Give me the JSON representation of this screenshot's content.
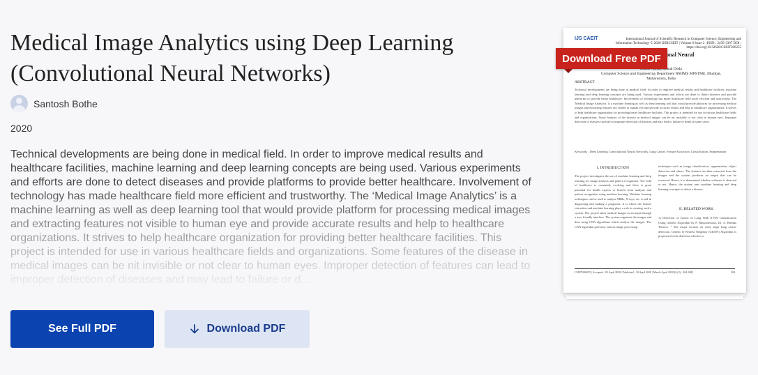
{
  "paper": {
    "title": "Medical Image Analytics using Deep Learning (Convolutional Neural Networks)",
    "author": "Santosh Bothe",
    "year": "2020",
    "abstract": "Technical developments are being done in medical field. In order to improve medical results and healthcare facilities, machine learning and deep learning concepts are being used. Various experiments and efforts are done to detect diseases and provide platforms to provide better healthcare. Involvement of technology has made healthcare field more efficient and trustworthy. The ‘Medical Image Analytics’ is a machine learning as well as deep learning tool that would provide platform for processing medical images and extracting features not visible to human eye and provide accurate results and help to healthcare organizations. It strives to help healthcare organization for providing better healthcare facilities. This project is intended for use in various healthcare fields and organizations. Some features of the disease in medical images can be nit invisible or not clear to human eyes. Improper detection of features can lead to improper detection of diseases and may lead to failure or d..."
  },
  "buttons": {
    "see_full_pdf": "See Full PDF",
    "download_pdf": "Download PDF"
  },
  "preview": {
    "badge": "Download Free PDF",
    "logo": "IJS CAEIT",
    "header": "International Journal of Scientific Research in Computer Science, Engineering and Information Technology © 2020 IJSRCSEIT | Volume 6 Issue 2 | ISSN : 2456-3307 DOI : https://doi.org/10.32628/CSEIT206255",
    "title_partial": "rning (Convolutional Neural",
    "authors": "Dhara Patidar, Kunal Doda\nComputer Science and Engineering Department NMIMS MPSTME, Mumbai, Maharashtra, India",
    "abstract_heading": "ABSTRACT",
    "abstract_text": "Technical developments are being done in medical field. In order to improve medical results and healthcare facilities, machine learning and deep learning concepts are being used. Various experiments and efforts are done to detect diseases and provide platforms to provide better healthcare. Involvement of technology has made healthcare field more efficient and trustworthy. The 'Medical Image Analytics' is a machine learning as well as deep learning tool that would provide platform for processing medical images and extracting features not visible to human eye and provide accurate results and help to healthcare organizations. It strives to help healthcare organization for providing better healthcare facilities. This project is intended for use in various healthcare fields and organizations. Some features of the disease in medical images can be nit invisible or not clear to human eyes. Improper detection of features can lead to improper detection of diseases and may lead to failure or death in some cases.",
    "keywords": "Keywords : Deep Learning Convolutional Neural Networks, Lung Cancer, Feature Extraction, Classification, Segmentation",
    "intro_heading": "I.   INTRODUCTION",
    "intro_text": "The project investigates the use of machine learning and deep learning for image analysis and pattern recognition. The field of healthcare is constantly evolving and there is great potential for health experts to benefit from analysis and pattern recognition using machine learning. Machine learning techniques can be used to analyse MRIs, X-rays, etc. to aid in diagnosing and making a prognosis. It is where the feature extraction and machine learning plays a role in creating such a system. The project takes medical images as an input through a user friendly interface. The system augments the images and then using CNN algorithms which analyse the images. The CNN algorithm performs various image processing",
    "col2_text": "techniques such as image classification, segmentation, object detection and others. The features are then extracted from the images and the system produces an output that can be reviewed. Hence, it is determined whether a disease is detected or not. Hence, the system uses machine learning and deep learning concepts to detect a disease.",
    "related_heading": "II.   RELATED WORK",
    "related_text": "1) Detection of Cancer in Lung With K-NN Classification Using Genetic Algorithm by P. Bhuvaneswari, Dr. A. Brintha Therese. • The major focuses on early stage lung cancer detection. Genetic K-Nearest Neighbor (GKNN) Algorithm is proposed for the detection which is a",
    "footer_left": "CSEIT206255 | Accepted : 05 April 2020 | Published : 10 April 2020 | March-April 2020 [6 (2) : 304-308]",
    "footer_right": "304"
  },
  "colors": {
    "primary": "#0b43b0",
    "secondary_bg": "#dde5f4",
    "badge": "#c8241d"
  },
  "icons": {
    "download": "download-arrow-icon",
    "avatar": "user-avatar-icon"
  }
}
